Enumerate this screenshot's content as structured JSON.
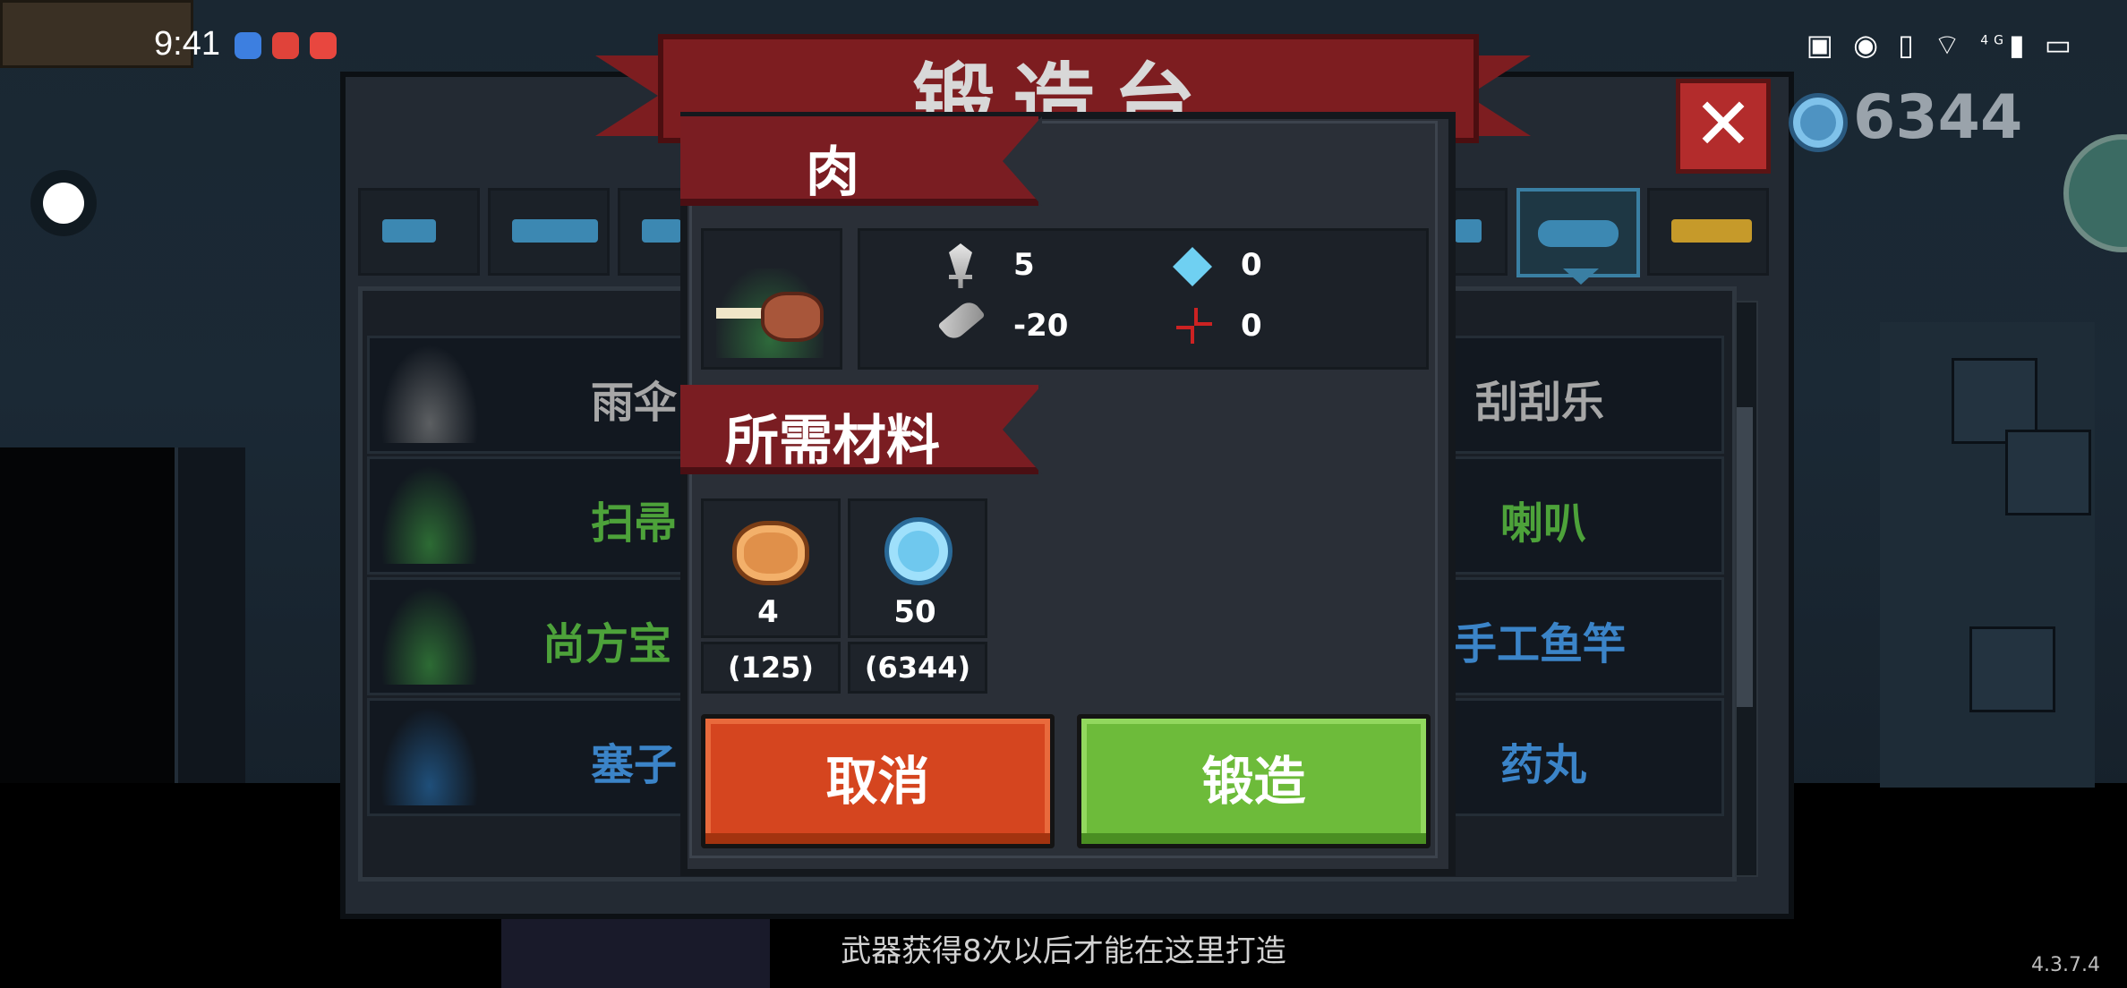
{
  "status_bar": {
    "time": "9:41",
    "right_icons": [
      "cast-icon",
      "eye-icon",
      "vibrate-icon",
      "wifi-icon",
      "signal-4g-icon",
      "battery-charging-icon"
    ],
    "signal_label": "4G"
  },
  "forge": {
    "title": "锻造台",
    "close_label": "✕",
    "gems": "6344",
    "tabs": [
      {
        "icon": "pistol-icon"
      },
      {
        "icon": "rifle-icon"
      },
      {
        "icon": "shotgun-icon"
      },
      {
        "icon": "fish-icon",
        "active": true
      },
      {
        "icon": "crown-icon"
      }
    ],
    "list": {
      "rows": [
        {
          "left": "雨伞",
          "right": "刮刮乐",
          "left_color": "#a7a7a7",
          "right_color": "#a7a7a7",
          "icon": "umbrella-icon"
        },
        {
          "left": "扫帚",
          "right": "喇叭",
          "left_color": "#4da23a",
          "right_color": "#4da23a",
          "icon": "broom-icon"
        },
        {
          "left": "尚方宝",
          "right": "手工鱼竿",
          "left_color": "#4da23a",
          "right_color": "#3b84c8",
          "icon": "fish-sword-icon"
        },
        {
          "left": "塞子",
          "right": "药丸",
          "left_color": "#3b84c8",
          "right_color": "#3b84c8",
          "icon": "plunger-icon"
        }
      ]
    }
  },
  "modal": {
    "item_name": "肉",
    "item_icon": "meat-drumstick-icon",
    "stats": {
      "damage": "5",
      "energy": "0",
      "crit": "-20",
      "accuracy": "0"
    },
    "materials_header": "所需材料",
    "materials": [
      {
        "icon": "ore-icon",
        "count": "4",
        "have": "(125)"
      },
      {
        "icon": "gem-icon",
        "count": "50",
        "have": "(6344)"
      }
    ],
    "cancel_label": "取消",
    "forge_label": "锻造"
  },
  "footer": {
    "hint": "武器获得8次以后才能在这里打造",
    "version": "4.3.7.4"
  }
}
